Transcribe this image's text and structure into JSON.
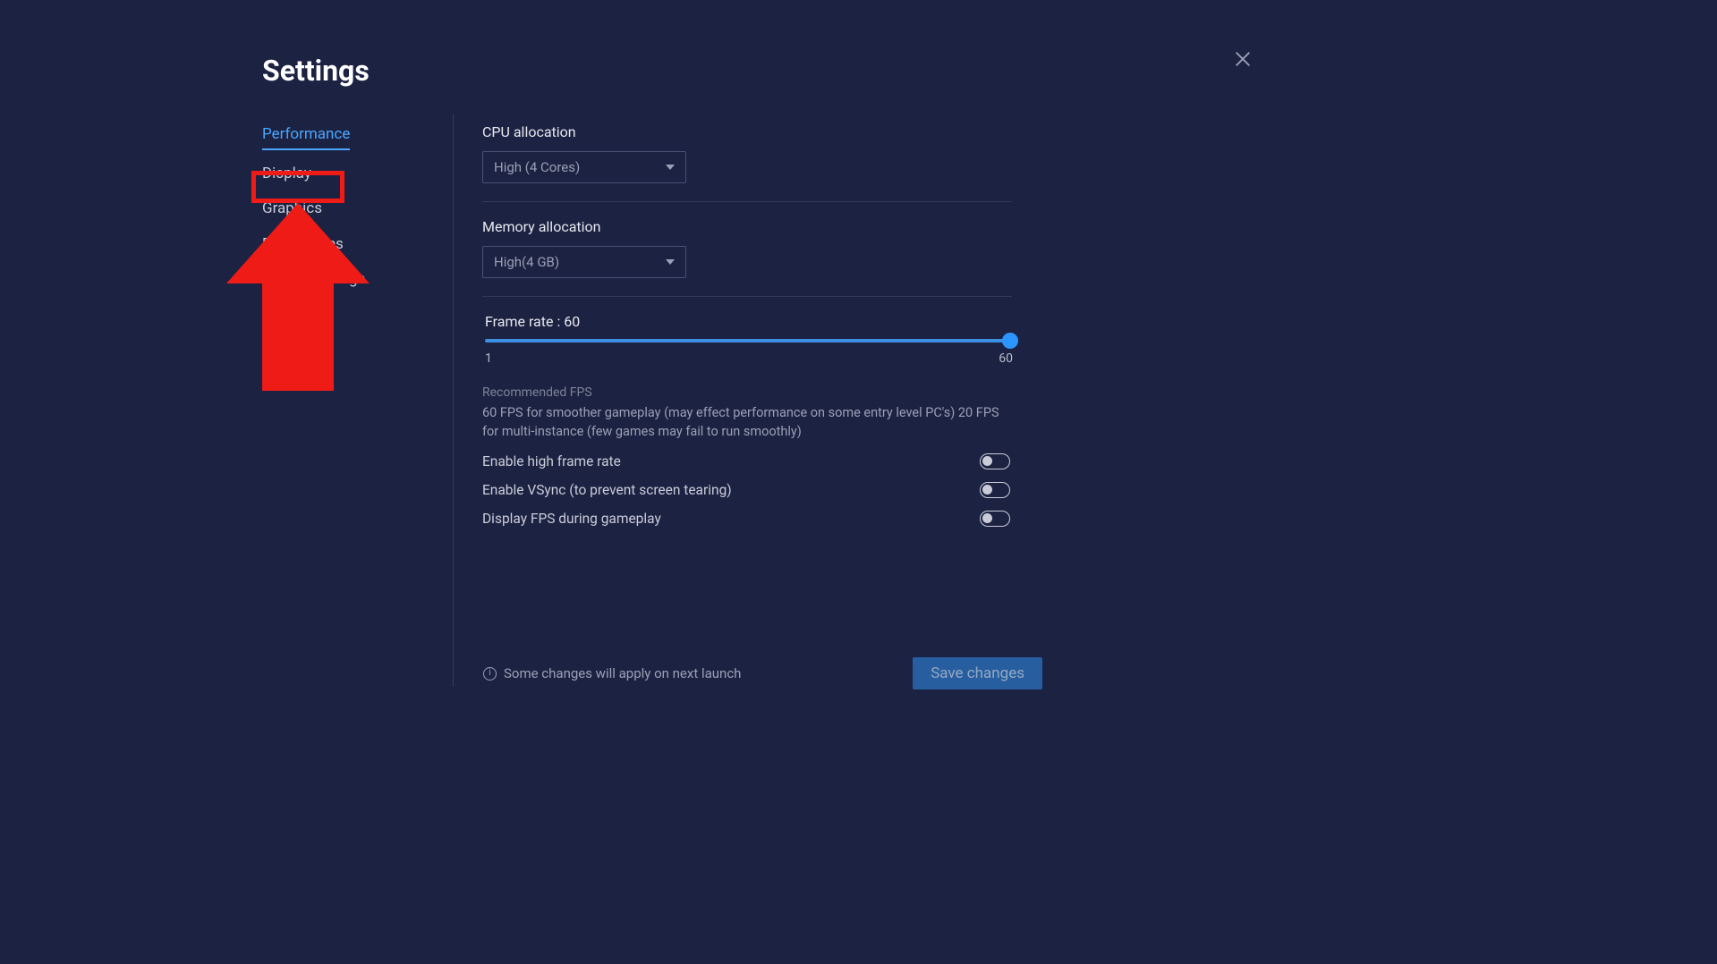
{
  "title": "Settings",
  "sidebar": {
    "items": [
      {
        "label": "Performance",
        "active": true
      },
      {
        "label": "Display",
        "active": false
      },
      {
        "label": "Graphics",
        "active": false
      },
      {
        "label": "Preferences",
        "active": false
      },
      {
        "label": "Device settings",
        "active": false
      }
    ]
  },
  "performance": {
    "cpu_label": "CPU allocation",
    "cpu_value": "High (4 Cores)",
    "mem_label": "Memory allocation",
    "mem_value": "High(4 GB)",
    "framerate_label": "Frame rate : 60",
    "slider_min": "1",
    "slider_max": "60",
    "rec_title": "Recommended FPS",
    "rec_body": "60 FPS for smoother gameplay (may effect performance on some entry level PC's) 20 FPS for multi-instance (few games may fail to run smoothly)",
    "toggles": [
      {
        "label": "Enable high frame rate",
        "on": false
      },
      {
        "label": "Enable VSync (to prevent screen tearing)",
        "on": false
      },
      {
        "label": "Display FPS during gameplay",
        "on": false
      }
    ]
  },
  "footer": {
    "note": "Some changes will apply on next launch",
    "save": "Save changes"
  },
  "annotation": {
    "highlighted_sidebar_item": "Graphics"
  }
}
